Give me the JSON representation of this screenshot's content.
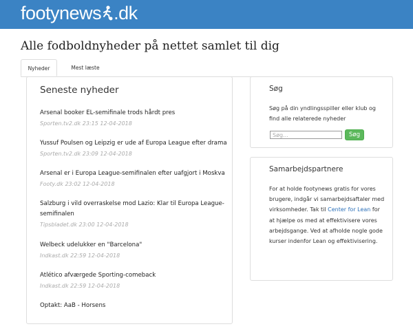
{
  "header": {
    "logo_left": "footynews",
    "logo_right": ".dk",
    "bg_color": "#3b83c4"
  },
  "page_title": "Alle fodboldnyheder på nettet samlet til dig",
  "tabs": [
    {
      "label": "Nyheder",
      "active": true
    },
    {
      "label": "Mest læste",
      "active": false
    }
  ],
  "news": {
    "heading": "Seneste nyheder",
    "items": [
      {
        "title": "Arsenal booker EL-semifinale trods hårdt pres",
        "meta": "Sporten.tv2.dk 23:15 12-04-2018"
      },
      {
        "title": "Yussuf Poulsen og Leipzig er ude af Europa League efter drama",
        "meta": "Sporten.tv2.dk 23:09 12-04-2018"
      },
      {
        "title": "Arsenal er i Europa League-semifinalen efter uafgjort i Moskva",
        "meta": "Footy.dk 23:02 12-04-2018"
      },
      {
        "title": "Salzburg i vild overraskelse mod Lazio: Klar til Europa League-semifinalen",
        "meta": "Tipsbladet.dk 23:00 12-04-2018"
      },
      {
        "title": "Welbeck udelukker en \"Barcelona\"",
        "meta": "Indkast.dk 22:59 12-04-2018"
      },
      {
        "title": "Atlético afværgede Sporting-comeback",
        "meta": "Indkast.dk 22:59 12-04-2018"
      },
      {
        "title": "Optakt: AaB - Horsens",
        "meta": ""
      }
    ]
  },
  "search": {
    "heading": "Søg",
    "description": "Søg på din yndlingsspiller eller klub og find alle relaterede nyheder",
    "placeholder": "Søg...",
    "button_label": "Søg",
    "button_color": "#5cb85c"
  },
  "partners": {
    "heading": "Samarbejdspartnere",
    "text_before": "For at holde footynews gratis for vores brugere, indgår vi samarbejdsaftaler med virksomheder. Tak til ",
    "link_text": "Center for Lean",
    "text_after": " for at hjælpe os med at effektivisere vores arbejdsgange. Ved at afholde nogle gode kurser indenfor Lean og effektivisering.",
    "link_color": "#2a6fb8"
  }
}
